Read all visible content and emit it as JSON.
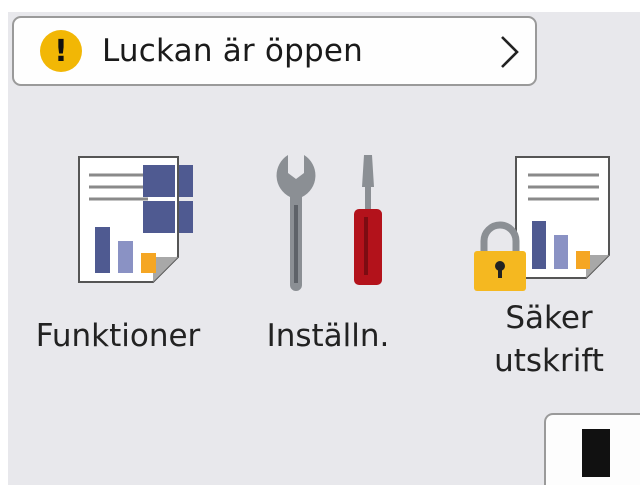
{
  "status_bar": {
    "message": "Luckan är öppen",
    "icon": "warning-icon",
    "icon_glyph": "!",
    "icon_color": "#f2b705",
    "chevron_icon": "chevron-right-icon"
  },
  "apps": [
    {
      "label": "Funktioner",
      "icon": "functions-icon"
    },
    {
      "label": "Inställn.",
      "icon": "settings-tools-icon"
    },
    {
      "label_line1": "Säker",
      "label_line2": "utskrift",
      "icon": "secure-print-icon"
    }
  ],
  "ink_button": {
    "icon": "ink-cartridge-icon"
  },
  "colors": {
    "background": "#e8e8ec",
    "grid_blue": "#4f5a91",
    "bar_blue": "#8a92c4",
    "bar_orange": "#f5a623",
    "tool_red": "#b3121b",
    "tool_gray": "#8b8f94",
    "lock_yellow": "#f5b820"
  }
}
